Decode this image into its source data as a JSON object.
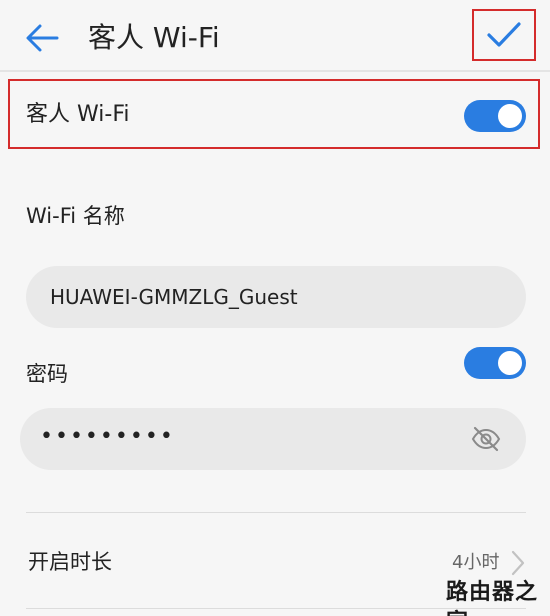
{
  "header": {
    "title": "客人 Wi-Fi"
  },
  "guest_wifi": {
    "label": "客人 Wi-Fi",
    "enabled": true
  },
  "wifi_name": {
    "label": "Wi-Fi 名称",
    "value": "HUAWEI-GMMZLG_Guest"
  },
  "password": {
    "label": "密码",
    "enabled": true,
    "masked_value": "•••••••••"
  },
  "duration": {
    "label": "开启时长",
    "value": "4小时"
  },
  "watermark": {
    "text": "路由器之家"
  },
  "colors": {
    "accent": "#2a7de1",
    "highlight_border": "#d42b2b"
  }
}
